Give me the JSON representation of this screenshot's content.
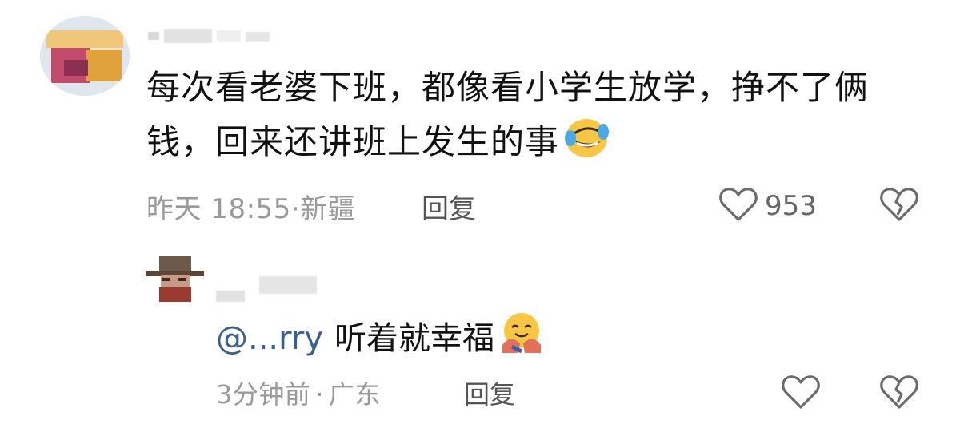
{
  "comment": {
    "text_line1": "每次看老婆下班，都像看小学生放学，挣不了俩",
    "text_line2": "钱，回来还讲班上发生的事",
    "emoji": "rofl-emoji",
    "time": "昨天 18:55",
    "separator": "·",
    "location": "新疆",
    "reply_label": "回复",
    "like_count": "953",
    "like_icon": "heart-outline-icon",
    "dislike_icon": "broken-heart-icon"
  },
  "reply": {
    "mention": "@...rry",
    "text": "听着就幸福",
    "emoji": "hugging-face-emoji",
    "time": "3分钟前",
    "separator": "·",
    "location": "广东",
    "reply_label": "回复",
    "like_icon": "heart-outline-icon",
    "dislike_icon": "broken-heart-icon"
  },
  "colors": {
    "text": "#111111",
    "meta": "#9a9a9a",
    "icon": "#6b6b6b",
    "mention": "#3a5f90"
  }
}
